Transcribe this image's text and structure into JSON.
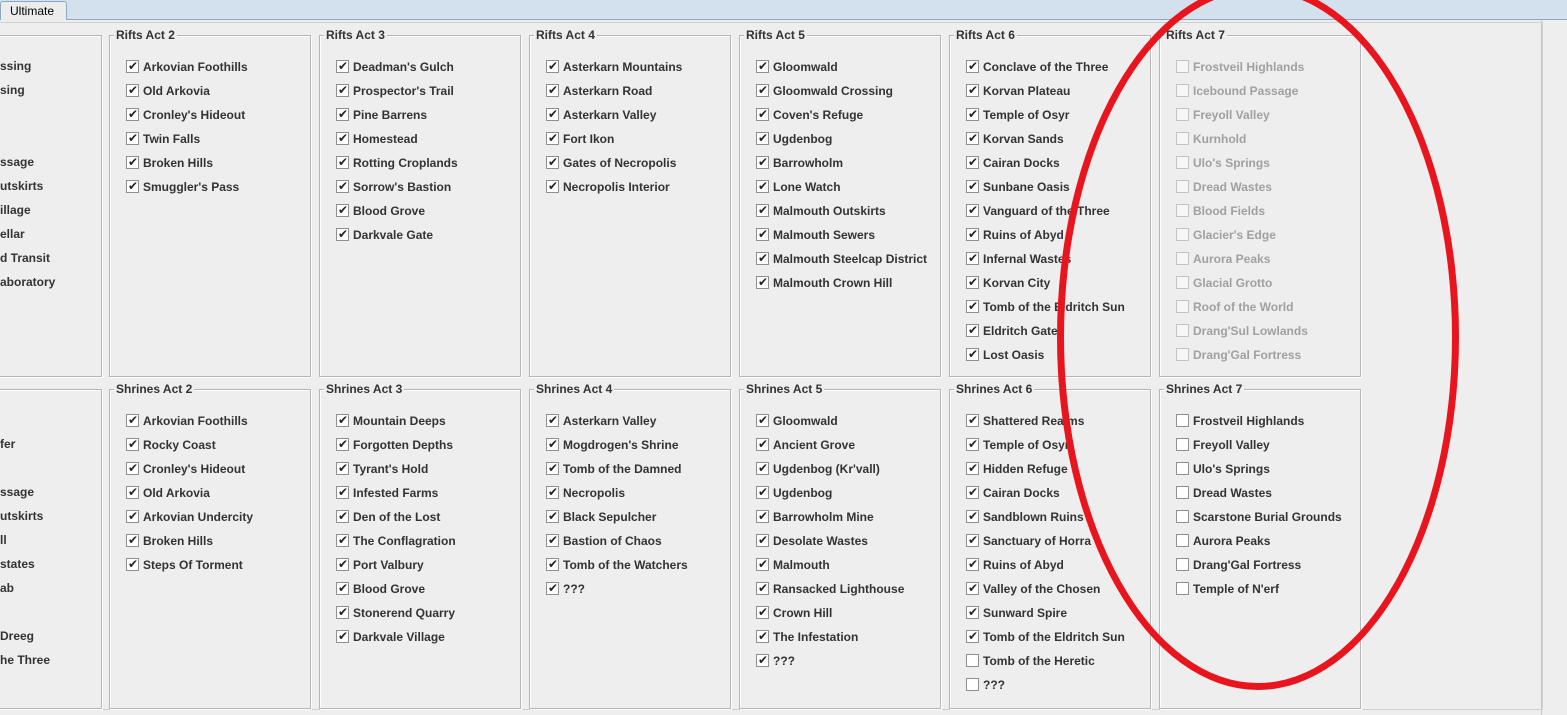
{
  "tabs": [
    {
      "label": "Ultimate"
    }
  ],
  "left_panel_top_cut": [
    "ssing",
    "sing",
    "ssage",
    "utskirts",
    "illage",
    "ellar",
    "d Transit",
    "aboratory"
  ],
  "left_panel_bottom_cut": [
    "fer",
    "ssage",
    "utskirts",
    "ll",
    "states",
    "ab",
    " Dreeg",
    "he Three"
  ],
  "rifts": [
    {
      "title": "Rifts Act 2",
      "items": [
        {
          "label": "Arkovian Foothills",
          "checked": true
        },
        {
          "label": "Old Arkovia",
          "checked": true
        },
        {
          "label": "Cronley's Hideout",
          "checked": true
        },
        {
          "label": "Twin Falls",
          "checked": true
        },
        {
          "label": "Broken Hills",
          "checked": true
        },
        {
          "label": "Smuggler's Pass",
          "checked": true
        }
      ]
    },
    {
      "title": "Rifts Act 3",
      "items": [
        {
          "label": "Deadman's Gulch",
          "checked": true
        },
        {
          "label": "Prospector's Trail",
          "checked": true
        },
        {
          "label": "Pine Barrens",
          "checked": true
        },
        {
          "label": "Homestead",
          "checked": true
        },
        {
          "label": "Rotting Croplands",
          "checked": true
        },
        {
          "label": "Sorrow's Bastion",
          "checked": true
        },
        {
          "label": "Blood Grove",
          "checked": true
        },
        {
          "label": "Darkvale Gate",
          "checked": true
        }
      ]
    },
    {
      "title": "Rifts Act 4",
      "items": [
        {
          "label": "Asterkarn Mountains",
          "checked": true
        },
        {
          "label": "Asterkarn Road",
          "checked": true
        },
        {
          "label": "Asterkarn Valley",
          "checked": true
        },
        {
          "label": "Fort Ikon",
          "checked": true
        },
        {
          "label": "Gates of Necropolis",
          "checked": true
        },
        {
          "label": "Necropolis Interior",
          "checked": true
        }
      ]
    },
    {
      "title": "Rifts Act 5",
      "items": [
        {
          "label": "Gloomwald",
          "checked": true
        },
        {
          "label": "Gloomwald Crossing",
          "checked": true
        },
        {
          "label": "Coven's Refuge",
          "checked": true
        },
        {
          "label": "Ugdenbog",
          "checked": true
        },
        {
          "label": "Barrowholm",
          "checked": true
        },
        {
          "label": "Lone Watch",
          "checked": true
        },
        {
          "label": "Malmouth Outskirts",
          "checked": true
        },
        {
          "label": "Malmouth Sewers",
          "checked": true
        },
        {
          "label": "Malmouth Steelcap District",
          "checked": true
        },
        {
          "label": "Malmouth Crown Hill",
          "checked": true
        }
      ]
    },
    {
      "title": "Rifts Act 6",
      "items": [
        {
          "label": "Conclave of the Three",
          "checked": true
        },
        {
          "label": "Korvan Plateau",
          "checked": true
        },
        {
          "label": "Temple of Osyr",
          "checked": true
        },
        {
          "label": "Korvan Sands",
          "checked": true
        },
        {
          "label": "Cairan Docks",
          "checked": true
        },
        {
          "label": "Sunbane Oasis",
          "checked": true
        },
        {
          "label": "Vanguard of the Three",
          "checked": true
        },
        {
          "label": "Ruins of Abyd",
          "checked": true
        },
        {
          "label": "Infernal Wastes",
          "checked": true
        },
        {
          "label": "Korvan City",
          "checked": true
        },
        {
          "label": "Tomb of the Eldritch Sun",
          "checked": true
        },
        {
          "label": "Eldritch Gate",
          "checked": true
        },
        {
          "label": "Lost Oasis",
          "checked": true
        }
      ]
    },
    {
      "title": "Rifts Act 7",
      "disabled": true,
      "items": [
        {
          "label": "Frostveil Highlands",
          "checked": false
        },
        {
          "label": "Icebound Passage",
          "checked": false
        },
        {
          "label": "Freyoll Valley",
          "checked": false
        },
        {
          "label": "Kurnhold",
          "checked": false
        },
        {
          "label": "Ulo's Springs",
          "checked": false
        },
        {
          "label": "Dread Wastes",
          "checked": false
        },
        {
          "label": "Blood Fields",
          "checked": false
        },
        {
          "label": "Glacier's Edge",
          "checked": false
        },
        {
          "label": "Aurora Peaks",
          "checked": false
        },
        {
          "label": "Glacial Grotto",
          "checked": false
        },
        {
          "label": "Roof of the World",
          "checked": false
        },
        {
          "label": "Drang'Sul Lowlands",
          "checked": false
        },
        {
          "label": "Drang'Gal Fortress",
          "checked": false
        }
      ]
    }
  ],
  "shrines": [
    {
      "title": "Shrines Act 2",
      "items": [
        {
          "label": "Arkovian Foothills",
          "checked": true
        },
        {
          "label": "Rocky Coast",
          "checked": true
        },
        {
          "label": "Cronley's Hideout",
          "checked": true
        },
        {
          "label": "Old Arkovia",
          "checked": true
        },
        {
          "label": "Arkovian Undercity",
          "checked": true
        },
        {
          "label": "Broken Hills",
          "checked": true
        },
        {
          "label": "Steps Of Torment",
          "checked": true
        }
      ]
    },
    {
      "title": "Shrines Act 3",
      "items": [
        {
          "label": "Mountain Deeps",
          "checked": true
        },
        {
          "label": "Forgotten Depths",
          "checked": true
        },
        {
          "label": "Tyrant's Hold",
          "checked": true
        },
        {
          "label": "Infested Farms",
          "checked": true
        },
        {
          "label": "Den of the Lost",
          "checked": true
        },
        {
          "label": "The Conflagration",
          "checked": true
        },
        {
          "label": "Port Valbury",
          "checked": true
        },
        {
          "label": "Blood Grove",
          "checked": true
        },
        {
          "label": "Stonerend Quarry",
          "checked": true
        },
        {
          "label": "Darkvale Village",
          "checked": true
        }
      ]
    },
    {
      "title": "Shrines Act 4",
      "items": [
        {
          "label": "Asterkarn Valley",
          "checked": true
        },
        {
          "label": "Mogdrogen's Shrine",
          "checked": true
        },
        {
          "label": "Tomb of the Damned",
          "checked": true
        },
        {
          "label": "Necropolis",
          "checked": true
        },
        {
          "label": "Black Sepulcher",
          "checked": true
        },
        {
          "label": "Bastion of Chaos",
          "checked": true
        },
        {
          "label": "Tomb of the Watchers",
          "checked": true
        },
        {
          "label": "???",
          "checked": true
        }
      ]
    },
    {
      "title": "Shrines Act 5",
      "items": [
        {
          "label": "Gloomwald",
          "checked": true
        },
        {
          "label": "Ancient Grove",
          "checked": true
        },
        {
          "label": "Ugdenbog (Kr'vall)",
          "checked": true
        },
        {
          "label": "Ugdenbog",
          "checked": true
        },
        {
          "label": "Barrowholm Mine",
          "checked": true
        },
        {
          "label": "Desolate Wastes",
          "checked": true
        },
        {
          "label": "Malmouth",
          "checked": true
        },
        {
          "label": "Ransacked Lighthouse",
          "checked": true
        },
        {
          "label": "Crown Hill",
          "checked": true
        },
        {
          "label": "The Infestation",
          "checked": true
        },
        {
          "label": "???",
          "checked": true
        }
      ]
    },
    {
      "title": "Shrines Act 6",
      "items": [
        {
          "label": "Shattered Realms",
          "checked": true
        },
        {
          "label": "Temple of Osyr",
          "checked": true
        },
        {
          "label": "Hidden Refuge",
          "checked": true
        },
        {
          "label": "Cairan Docks",
          "checked": true
        },
        {
          "label": "Sandblown Ruins",
          "checked": true
        },
        {
          "label": "Sanctuary of Horra",
          "checked": true
        },
        {
          "label": "Ruins of Abyd",
          "checked": true
        },
        {
          "label": "Valley of the Chosen",
          "checked": true
        },
        {
          "label": "Sunward Spire",
          "checked": true
        },
        {
          "label": "Tomb of the Eldritch Sun",
          "checked": true
        },
        {
          "label": "Tomb of the Heretic",
          "checked": false
        },
        {
          "label": "???",
          "checked": false
        }
      ]
    },
    {
      "title": "Shrines Act 7",
      "items": [
        {
          "label": "Frostveil Highlands",
          "checked": false
        },
        {
          "label": "Freyoll Valley",
          "checked": false
        },
        {
          "label": "Ulo's Springs",
          "checked": false
        },
        {
          "label": "Dread Wastes",
          "checked": false
        },
        {
          "label": "Scarstone Burial Grounds",
          "checked": false
        },
        {
          "label": "Aurora Peaks",
          "checked": false
        },
        {
          "label": "Drang'Gal Fortress",
          "checked": false
        },
        {
          "label": "Temple of N'erf",
          "checked": false
        }
      ]
    }
  ],
  "colors": {
    "annotation": "#e8141e",
    "panel_bg": "#eeeeee",
    "disabled_text": "#a0a0a0"
  },
  "icons": {
    "checked": "check-mark-icon"
  }
}
